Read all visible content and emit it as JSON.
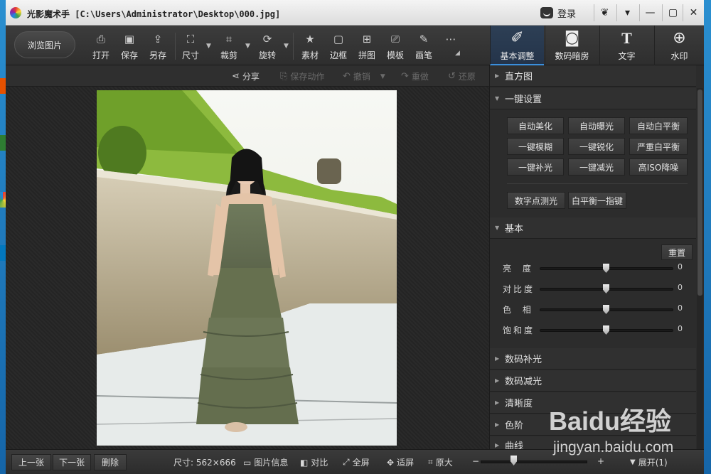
{
  "titlebar": {
    "title": "光影魔术手 [C:\\Users\\Administrator\\Desktop\\000.jpg]",
    "login": "登录",
    "controls": [
      "❦",
      "▾",
      "—",
      "▢",
      "✕"
    ]
  },
  "toolbar": {
    "browse": "浏览图片",
    "tools": [
      {
        "label": "打开",
        "icon": "open-icon"
      },
      {
        "label": "保存",
        "icon": "save-icon"
      },
      {
        "label": "另存",
        "icon": "save-as-icon"
      },
      {
        "label": "尺寸",
        "icon": "resize-icon"
      },
      {
        "label": "裁剪",
        "icon": "crop-icon"
      },
      {
        "label": "旋转",
        "icon": "rotate-icon"
      },
      {
        "label": "素材",
        "icon": "material-icon"
      },
      {
        "label": "边框",
        "icon": "border-icon"
      },
      {
        "label": "拼图",
        "icon": "collage-icon"
      },
      {
        "label": "模板",
        "icon": "template-icon"
      },
      {
        "label": "画笔",
        "icon": "brush-icon"
      },
      {
        "label": "",
        "icon": "more-icon"
      }
    ],
    "tabs": [
      {
        "label": "基本调整",
        "icon": "adjust-icon"
      },
      {
        "label": "数码暗房",
        "icon": "darkroom-icon"
      },
      {
        "label": "文字",
        "icon": "text-icon"
      },
      {
        "label": "水印",
        "icon": "watermark-icon"
      }
    ]
  },
  "actions": {
    "share": "分享",
    "save_action": "保存动作",
    "undo": "撤销",
    "redo": "重做",
    "restore": "还原"
  },
  "panel": {
    "histogram": "直方图",
    "oneclick": "一键设置",
    "buttons": [
      "自动美化",
      "自动曝光",
      "自动白平衡",
      "一键模糊",
      "一键锐化",
      "严重白平衡",
      "一键补光",
      "一键减光",
      "高ISO降噪"
    ],
    "metering": "数字点测光",
    "wb_finger": "白平衡一指键",
    "basic": "基本",
    "reset": "重置",
    "sliders": [
      {
        "label": "亮 度",
        "value": "0"
      },
      {
        "label": "对比度",
        "value": "0"
      },
      {
        "label": "色 相",
        "value": "0"
      },
      {
        "label": "饱和度",
        "value": "0"
      }
    ],
    "more_sections": [
      "数码补光",
      "数码减光",
      "清晰度",
      "色阶",
      "曲线"
    ]
  },
  "bottom": {
    "prev": "上一张",
    "next": "下一张",
    "delete": "删除",
    "size": "尺寸: 562×666",
    "info": "图片信息",
    "compare": "对比",
    "fullscreen": "全屏",
    "fit": "适屏",
    "original": "原大",
    "minus": "−",
    "plus": "+",
    "expand": "展开(1)"
  },
  "watermark": {
    "line1": "Baidu经验",
    "line2": "jingyan.baidu.com"
  },
  "colors": {
    "accent": "#3a8fdc",
    "panel_bg": "#2c2c2c",
    "toolbar_bg": "#333333"
  }
}
